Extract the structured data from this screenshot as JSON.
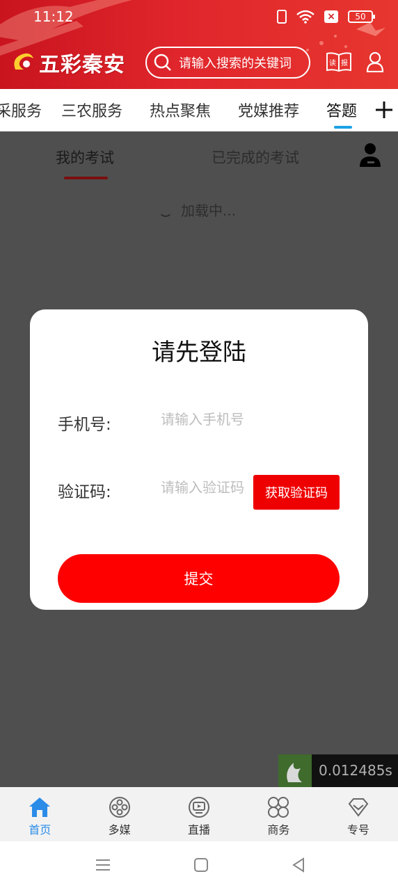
{
  "status_bar": {
    "time": "11:12",
    "battery": "50"
  },
  "header": {
    "logo_text": "五彩秦安",
    "search_placeholder": "请输入搜索的关键词",
    "read_label": "读报"
  },
  "tabs": [
    {
      "label": "采服务"
    },
    {
      "label": "三农服务"
    },
    {
      "label": "热点聚焦"
    },
    {
      "label": "党媒推荐"
    },
    {
      "label": "答题"
    }
  ],
  "exam": {
    "tabs": [
      {
        "label": "我的考试"
      },
      {
        "label": "已完成的考试"
      }
    ],
    "loading_text": "加载中..."
  },
  "login_modal": {
    "title": "请先登陆",
    "phone_label": "手机号:",
    "phone_placeholder": "请输入手机号",
    "code_label": "验证码:",
    "code_placeholder": "请输入验证码",
    "get_code_label": "获取验证码",
    "submit_label": "提交"
  },
  "timer_overlay": {
    "value": "0.012485s"
  },
  "bottom_nav": [
    {
      "label": "首页",
      "icon": "home-icon",
      "active": true
    },
    {
      "label": "多媒",
      "icon": "film-reel-icon"
    },
    {
      "label": "直播",
      "icon": "tv-icon"
    },
    {
      "label": "商务",
      "icon": "grid-icon"
    },
    {
      "label": "专号",
      "icon": "diamond-icon"
    }
  ],
  "colors": {
    "brand_red": "#e0262c",
    "accent_blue": "#1aa1e5",
    "submit_red": "#fe0000",
    "nav_active": "#2b8ce8"
  }
}
